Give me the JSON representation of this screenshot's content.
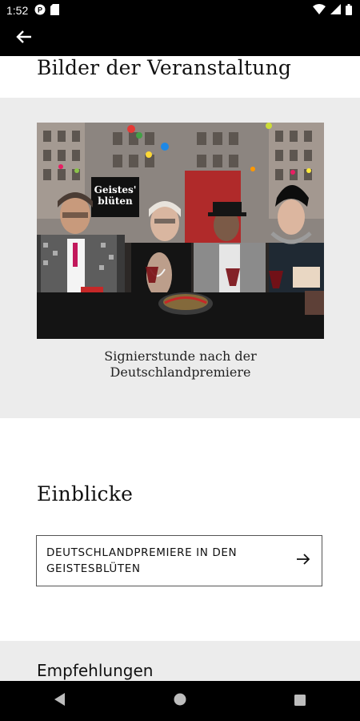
{
  "status_bar": {
    "time": "1:52",
    "icons": [
      "app-notification-icon",
      "sd-card-icon",
      "wifi-icon",
      "signal-icon",
      "battery-icon"
    ]
  },
  "app_bar": {
    "back_icon": "arrow-left-icon"
  },
  "gallery": {
    "title": "Bilder der Veranstaltung",
    "photo": {
      "sign_text_line1": "Geistes'",
      "sign_text_line2": "blüten"
    },
    "caption_line1": "Signierstunde nach der",
    "caption_line2": "Deutschlandpremiere"
  },
  "insights": {
    "title": "Einblicke",
    "button_line1": "DEUTSCHLANDPREMIERE IN DEN",
    "button_line2": "GEISTESBLÜTEN",
    "button_icon": "arrow-right-icon"
  },
  "recommendations": {
    "title": "Empfehlungen"
  },
  "nav": {
    "icons": [
      "back-triangle-icon",
      "home-circle-icon",
      "recents-square-icon"
    ]
  },
  "colors": {
    "bar_background": "#000000",
    "section_gray": "#ececec",
    "text": "#111111"
  }
}
